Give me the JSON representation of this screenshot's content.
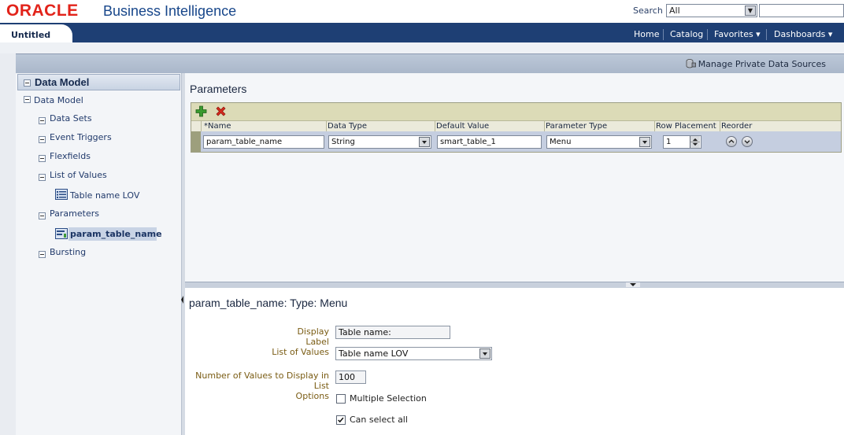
{
  "header": {
    "logo_text": "ORACLE",
    "product_name": "Business Intelligence",
    "search_label": "Search",
    "search_scope": "All"
  },
  "nav": {
    "doc_tab": "Untitled",
    "home": "Home",
    "catalog": "Catalog",
    "favorites": "Favorites ▾",
    "dashboards": "Dashboards ▾"
  },
  "toolbar": {
    "manage_private_data_sources": "Manage Private Data Sources"
  },
  "left_panel": {
    "header": "Data Model",
    "root": "Data Model",
    "items": {
      "data_sets": "Data Sets",
      "event_triggers": "Event Triggers",
      "flexfields": "Flexfields",
      "list_of_values": "List of Values",
      "lov_child": "Table name LOV",
      "parameters": "Parameters",
      "param_child": "param_table_name",
      "bursting": "Bursting"
    }
  },
  "parameters_panel": {
    "title": "Parameters",
    "columns": {
      "name": "*Name",
      "data_type": "Data Type",
      "default_value": "Default Value",
      "parameter_type": "Parameter Type",
      "row_placement": "Row Placement",
      "reorder": "Reorder"
    },
    "row": {
      "name": "param_table_name",
      "data_type": "String",
      "default_value": "smart_table_1",
      "parameter_type": "Menu",
      "row_placement": "1"
    }
  },
  "detail_panel": {
    "title": "param_table_name: Type: Menu",
    "display_label_label": "Display Label",
    "display_label_value": "Table name:",
    "list_of_values_label": "List of Values",
    "list_of_values_value": "Table name LOV",
    "num_values_label": "Number of Values to Display in List",
    "num_values_value": "100",
    "options_label": "Options",
    "multiple_selection_label": "Multiple Selection",
    "multiple_selection_checked": false,
    "can_select_all_label": "Can select all",
    "can_select_all_checked": true
  },
  "colors": {
    "oracle_red": "#e2231a",
    "nav_blue": "#1e3f74",
    "grid_toolbar": "#dcdbb7",
    "selected_row": "#c5cee0",
    "form_label": "#7a5c14"
  }
}
